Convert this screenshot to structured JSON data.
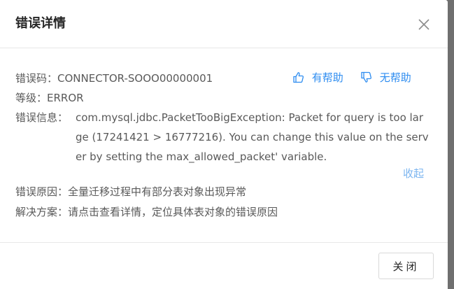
{
  "dialog": {
    "title": "错误详情"
  },
  "details": {
    "code_label": "错误码：",
    "code_value": "CONNECTOR-SOOO00000001",
    "level_label": "等级：",
    "level_value": "ERROR",
    "message_label": "错误信息：",
    "message_value": "com.mysql.jdbc.PacketTooBigException: Packet for query is too large (17241421 > 16777216). You can change this value on the server by setting the max_allowed_packet' variable.",
    "collapse_label": "收起",
    "cause_label": "错误原因：",
    "cause_value": "全量迁移过程中有部分表对象出现异常",
    "solution_label": "解决方案：",
    "solution_value": "请点击查看详情，定位具体表对象的错误原因"
  },
  "feedback": {
    "helpful_label": "有帮助",
    "not_helpful_label": "无帮助",
    "accent_color": "#2d8cf0"
  },
  "footer": {
    "close_label": "关闭"
  }
}
